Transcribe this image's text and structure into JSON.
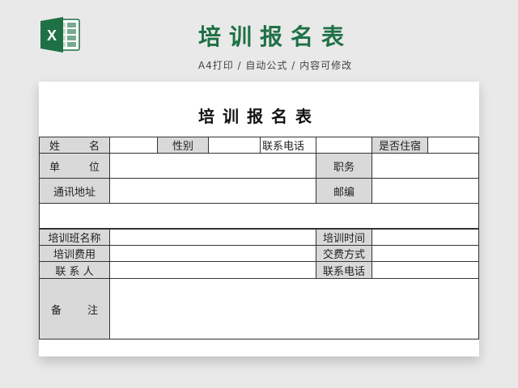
{
  "header": {
    "title": "培训报名表",
    "subtitle": "A4打印 / 自动公式 / 内容可修改",
    "accent_color": "#1e7145",
    "logo_letter": "X"
  },
  "sheet": {
    "title": "培训报名表",
    "labels": {
      "name_a": "姓",
      "name_b": "名",
      "gender": "性别",
      "phone": "联系电话",
      "lodging": "是否住宿",
      "unit_a": "单",
      "unit_b": "位",
      "position": "职务",
      "address": "通讯地址",
      "postcode": "邮编",
      "class_name": "培训班名称",
      "train_time": "培训时间",
      "train_fee": "培训费用",
      "pay_method": "交费方式",
      "contact": "联 系 人",
      "phone2": "联系电话",
      "remark_a": "备",
      "remark_b": "注"
    }
  }
}
